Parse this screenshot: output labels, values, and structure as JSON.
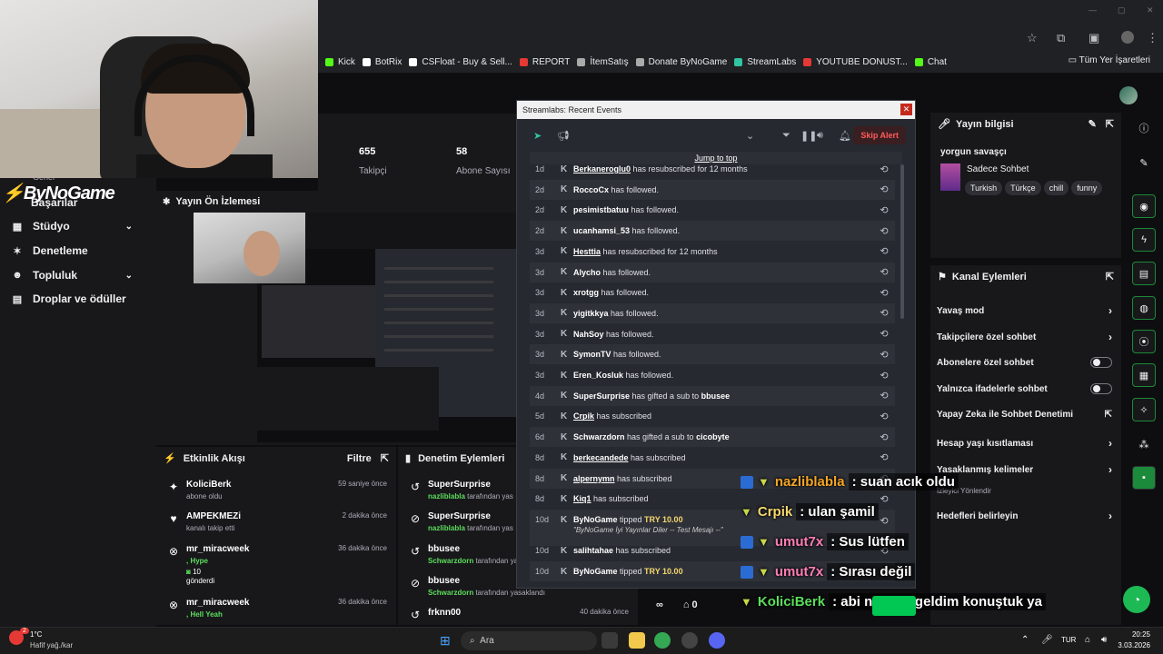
{
  "bookmarks": [
    {
      "label": "Kick",
      "color": "#53fc18"
    },
    {
      "label": "BotRix",
      "color": "#ffffff"
    },
    {
      "label": "CSFloat - Buy & Sell...",
      "color": "#ffffff"
    },
    {
      "label": "REPORT",
      "color": "#e53935"
    },
    {
      "label": "İtemSatış",
      "color": "#aaaaaa"
    },
    {
      "label": "Donate ByNoGame",
      "color": "#aaaaaa"
    },
    {
      "label": "StreamLabs",
      "color": "#31c3a2"
    },
    {
      "label": "YOUTUBE DONUST...",
      "color": "#e53935"
    },
    {
      "label": "Chat",
      "color": "#53fc18"
    }
  ],
  "bookmarks_right": "Tüm Yer İşaretleri",
  "sidebar": {
    "logo": "ByNoGame",
    "partial_top": "Genel",
    "partial_second": "Başarılar",
    "items": [
      {
        "label": "Stüdyo",
        "has_chevron": true
      },
      {
        "label": "Denetleme",
        "has_chevron": false
      },
      {
        "label": "Topluluk",
        "has_chevron": true
      },
      {
        "label": "Droplar ve ödüller",
        "has_chevron": false
      }
    ]
  },
  "stats": {
    "followers_value": "655",
    "followers_label": "Takipçi",
    "subs_value": "58",
    "subs_label": "Abone Sayısı"
  },
  "preview": {
    "title": "Yayın Ön İzlemesi"
  },
  "activity": {
    "title": "Etkinlik Akışı",
    "filter": "Filtre",
    "items": [
      {
        "icon": "✦",
        "name": "KoliciBerk",
        "sub": "abone oldu",
        "time": "59 saniye önce"
      },
      {
        "icon": "♥",
        "name": "AMPEKMEZi",
        "sub": "kanalı takip etti",
        "time": "2 dakika önce"
      },
      {
        "icon": "⊗",
        "name": "mr_miracweek",
        "hl": ", Hype",
        "extra1": "10",
        "extra2": "gönderdi",
        "time": "36 dakika önce"
      },
      {
        "icon": "⊗",
        "name": "mr_miracweek",
        "hl": ", Hell Yeah",
        "time": "36 dakika önce"
      }
    ]
  },
  "moderation": {
    "title": "Denetim Eylemleri",
    "items": [
      {
        "icon": "↺",
        "name": "SuperSurprise",
        "user": "nazliblabla",
        "rest": " tarafından yas",
        "time": ""
      },
      {
        "icon": "⊘",
        "name": "SuperSurprise",
        "user": "nazliblabla",
        "rest": " tarafından yas",
        "time": ""
      },
      {
        "icon": "↺",
        "name": "bbusee",
        "user": "Schwarzdorn",
        "rest": " tarafından yas",
        "time": ""
      },
      {
        "icon": "⊘",
        "name": "bbusee",
        "user": "Schwarzdorn",
        "rest": " tarafından yasaklandı",
        "time": ""
      },
      {
        "icon": "↺",
        "name": "frknn00",
        "user": "",
        "rest": "",
        "time": "40 dakika önce"
      }
    ]
  },
  "streamlabs": {
    "window_title": "Streamlabs: Recent Events",
    "skip_label": "Skip Alert",
    "jump_label": "Jump to top",
    "events": [
      {
        "age": "1d",
        "name": "Berkaneroglu0",
        "text": " has resubscribed for 12 months",
        "u": true
      },
      {
        "age": "2d",
        "name": "RoccoCx",
        "text": " has followed."
      },
      {
        "age": "2d",
        "name": "pesimistbatuu",
        "text": " has followed."
      },
      {
        "age": "2d",
        "name": "ucanhamsi_53",
        "text": " has followed."
      },
      {
        "age": "3d",
        "name": "Hesttia",
        "text": " has resubscribed for 12 months",
        "u": true
      },
      {
        "age": "3d",
        "name": "Alycho",
        "text": " has followed."
      },
      {
        "age": "3d",
        "name": "xrotgg",
        "text": " has followed."
      },
      {
        "age": "3d",
        "name": "yigitkkya",
        "text": " has followed."
      },
      {
        "age": "3d",
        "name": "NahSoy",
        "text": " has followed."
      },
      {
        "age": "3d",
        "name": "SymonTV",
        "text": " has followed."
      },
      {
        "age": "3d",
        "name": "Eren_Kosluk",
        "text": " has followed."
      },
      {
        "age": "4d",
        "name": "SuperSurprise",
        "text": " has gifted a sub to ",
        "target": "bbusee"
      },
      {
        "age": "5d",
        "name": "Crpik",
        "text": " has subscribed",
        "u": true
      },
      {
        "age": "6d",
        "name": "Schwarzdorn",
        "text": " has gifted a sub to ",
        "target": "cicobyte"
      },
      {
        "age": "8d",
        "name": "berkecandede",
        "text": " has subscribed",
        "u": true
      },
      {
        "age": "8d",
        "name": "alpernymn",
        "text": " has subscribed",
        "u": true
      },
      {
        "age": "8d",
        "name": "Kiq1",
        "text": " has subscribed",
        "u": true
      }
    ],
    "tip1": {
      "age": "10d",
      "name": "ByNoGame",
      "text": " tipped ",
      "amount": "TRY 10.00",
      "message": "\"ByNoGame İyi Yayınlar Diler -- Test Mesajı --\""
    },
    "sub_after": {
      "age": "10d",
      "name": "salihtahae",
      "text": " has subscribed"
    },
    "tip2": {
      "age": "10d",
      "name": "ByNoGame",
      "text": " tipped ",
      "amount": "TRY 10.00"
    }
  },
  "info": {
    "title": "Yayın bilgisi",
    "stream_title": "yorgun savaşçı",
    "category": "Sadece Sohbet",
    "tags": [
      "Turkish",
      "Türkçe",
      "chill",
      "funny"
    ]
  },
  "channel_actions": {
    "title": "Kanal Eylemleri",
    "items": [
      {
        "label": "Yavaş mod",
        "kind": "chevron"
      },
      {
        "label": "Takipçilere özel sohbet",
        "kind": "chevron"
      },
      {
        "label": "Abonelere özel sohbet",
        "kind": "toggle"
      },
      {
        "label": "Yalnızca ifadelerle sohbet",
        "kind": "toggle"
      },
      {
        "label": "Yapay Zeka ile Sohbet Denetimi",
        "kind": "external"
      },
      {
        "label": "Hesap yaşı kısıtlaması",
        "kind": "chevron"
      },
      {
        "label": "Yasaklanmış kelimeler",
        "kind": "chevron"
      },
      {
        "label": "İzleyici Yönlendir",
        "kind": "none"
      },
      {
        "label": "Hedefleri belirleyin",
        "kind": "chevron"
      }
    ]
  },
  "chat": [
    {
      "user": "nazliblabla",
      "color": "#f5a623",
      "msg": ": suan acık oldu",
      "badge": true
    },
    {
      "user": "Crpik",
      "color": "#f5d76e",
      "msg": ": ulan şamil",
      "badge": false
    },
    {
      "user": "umut7x",
      "color": "#ff7eb6",
      "msg": ": Sus lütfen",
      "badge": true
    },
    {
      "user": "umut7x",
      "color": "#ff7eb6",
      "msg": ": Sırası değil",
      "badge": true
    },
    {
      "user": "KoliciBerk",
      "color": "#5cde5c",
      "msg": ": abi ne nası geldim konuştuk ya",
      "badge": false
    }
  ],
  "bottom_counts": {
    "viewers": "0"
  },
  "taskbar": {
    "temp": "1°C",
    "weather": "Hafif yağ./kar",
    "search": "Ara",
    "lang": "TUR",
    "time": "20:25",
    "date": "3.03.2026",
    "notif": "2"
  }
}
